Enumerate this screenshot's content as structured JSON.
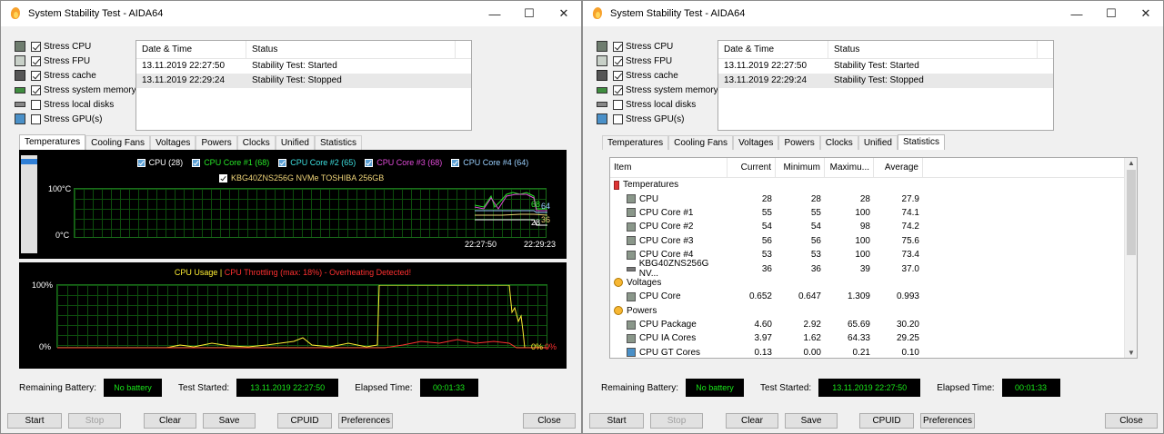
{
  "window_title": "System Stability Test - AIDA64",
  "window_buttons": {
    "min": "—",
    "max": "☐",
    "close": "✕"
  },
  "stress": [
    {
      "label": "Stress CPU",
      "checked": true,
      "icon": "cpu-icon"
    },
    {
      "label": "Stress FPU",
      "checked": true,
      "icon": "fpu-icon"
    },
    {
      "label": "Stress cache",
      "checked": true,
      "icon": "cache-icon"
    },
    {
      "label": "Stress system memory",
      "checked": true,
      "icon": "memory-icon"
    },
    {
      "label": "Stress local disks",
      "checked": false,
      "icon": "disk-icon"
    },
    {
      "label": "Stress GPU(s)",
      "checked": false,
      "icon": "gpu-icon"
    }
  ],
  "log": {
    "headers": [
      "Date & Time",
      "Status"
    ],
    "rows": [
      [
        "13.11.2019 22:27:50",
        "Stability Test: Started"
      ],
      [
        "13.11.2019 22:29:24",
        "Stability Test: Stopped"
      ]
    ]
  },
  "tabs": [
    "Temperatures",
    "Cooling Fans",
    "Voltages",
    "Powers",
    "Clocks",
    "Unified",
    "Statistics"
  ],
  "temp_graph": {
    "legend": [
      "CPU (28)",
      "CPU Core #1 (68)",
      "CPU Core #2 (65)",
      "CPU Core #3 (68)",
      "CPU Core #4 (64)"
    ],
    "legend_colors": [
      "#ffffff",
      "#27e627",
      "#3ee0e0",
      "#e04bd8",
      "#9ad0ff"
    ],
    "legend2": "KBG40ZNS256G NVMe TOSHIBA 256GB",
    "ymax": "100°C",
    "ymin": "0°C",
    "time_start": "22:27:50",
    "time_end": "22:29:23",
    "val_tags": [
      "68",
      "64",
      "28",
      "36"
    ]
  },
  "usage_graph": {
    "title_a": "CPU Usage",
    "sep": "|",
    "title_b": "CPU Throttling (max: 18%) - Overheating Detected!",
    "ymax": "100%",
    "ymin": "0%",
    "end_a": "0%",
    "end_b": "0%"
  },
  "status": {
    "battery_label": "Remaining Battery:",
    "battery": "No battery",
    "started_label": "Test Started:",
    "started": "13.11.2019 22:27:50",
    "elapsed_label": "Elapsed Time:",
    "elapsed": "00:01:33"
  },
  "buttons": {
    "start": "Start",
    "stop": "Stop",
    "clear": "Clear",
    "save": "Save",
    "cpuid": "CPUID",
    "preferences": "Preferences",
    "close": "Close"
  },
  "stats": {
    "headers": [
      "Item",
      "Current",
      "Minimum",
      "Maximu...",
      "Average"
    ],
    "rows": [
      {
        "group": true,
        "icon": "thermometer-icon",
        "name": "Temperatures",
        "v": [
          "",
          "",
          "",
          ""
        ]
      },
      {
        "icon": "cpu-icon",
        "name": "CPU",
        "v": [
          "28",
          "28",
          "28",
          "27.9"
        ]
      },
      {
        "icon": "cpu-icon",
        "name": "CPU Core #1",
        "v": [
          "55",
          "55",
          "100",
          "74.1"
        ]
      },
      {
        "icon": "cpu-icon",
        "name": "CPU Core #2",
        "v": [
          "54",
          "54",
          "98",
          "74.2"
        ]
      },
      {
        "icon": "cpu-icon",
        "name": "CPU Core #3",
        "v": [
          "56",
          "56",
          "100",
          "75.6"
        ]
      },
      {
        "icon": "cpu-icon",
        "name": "CPU Core #4",
        "v": [
          "53",
          "53",
          "100",
          "73.4"
        ]
      },
      {
        "icon": "disk-icon",
        "name": "KBG40ZNS256G NV...",
        "v": [
          "36",
          "36",
          "39",
          "37.0"
        ]
      },
      {
        "group": true,
        "icon": "bolt-icon",
        "name": "Voltages",
        "v": [
          "",
          "",
          "",
          ""
        ]
      },
      {
        "icon": "cpu-icon",
        "name": "CPU Core",
        "v": [
          "0.652",
          "0.647",
          "1.309",
          "0.993"
        ]
      },
      {
        "group": true,
        "icon": "bolt-icon",
        "name": "Powers",
        "v": [
          "",
          "",
          "",
          ""
        ]
      },
      {
        "icon": "cpu-icon",
        "name": "CPU Package",
        "v": [
          "4.60",
          "2.92",
          "65.69",
          "30.20"
        ]
      },
      {
        "icon": "cpu-icon",
        "name": "CPU IA Cores",
        "v": [
          "3.97",
          "1.62",
          "64.33",
          "29.25"
        ]
      },
      {
        "icon": "gpu-icon",
        "name": "CPU GT Cores",
        "v": [
          "0.13",
          "0.00",
          "0.21",
          "0.10"
        ]
      }
    ]
  }
}
